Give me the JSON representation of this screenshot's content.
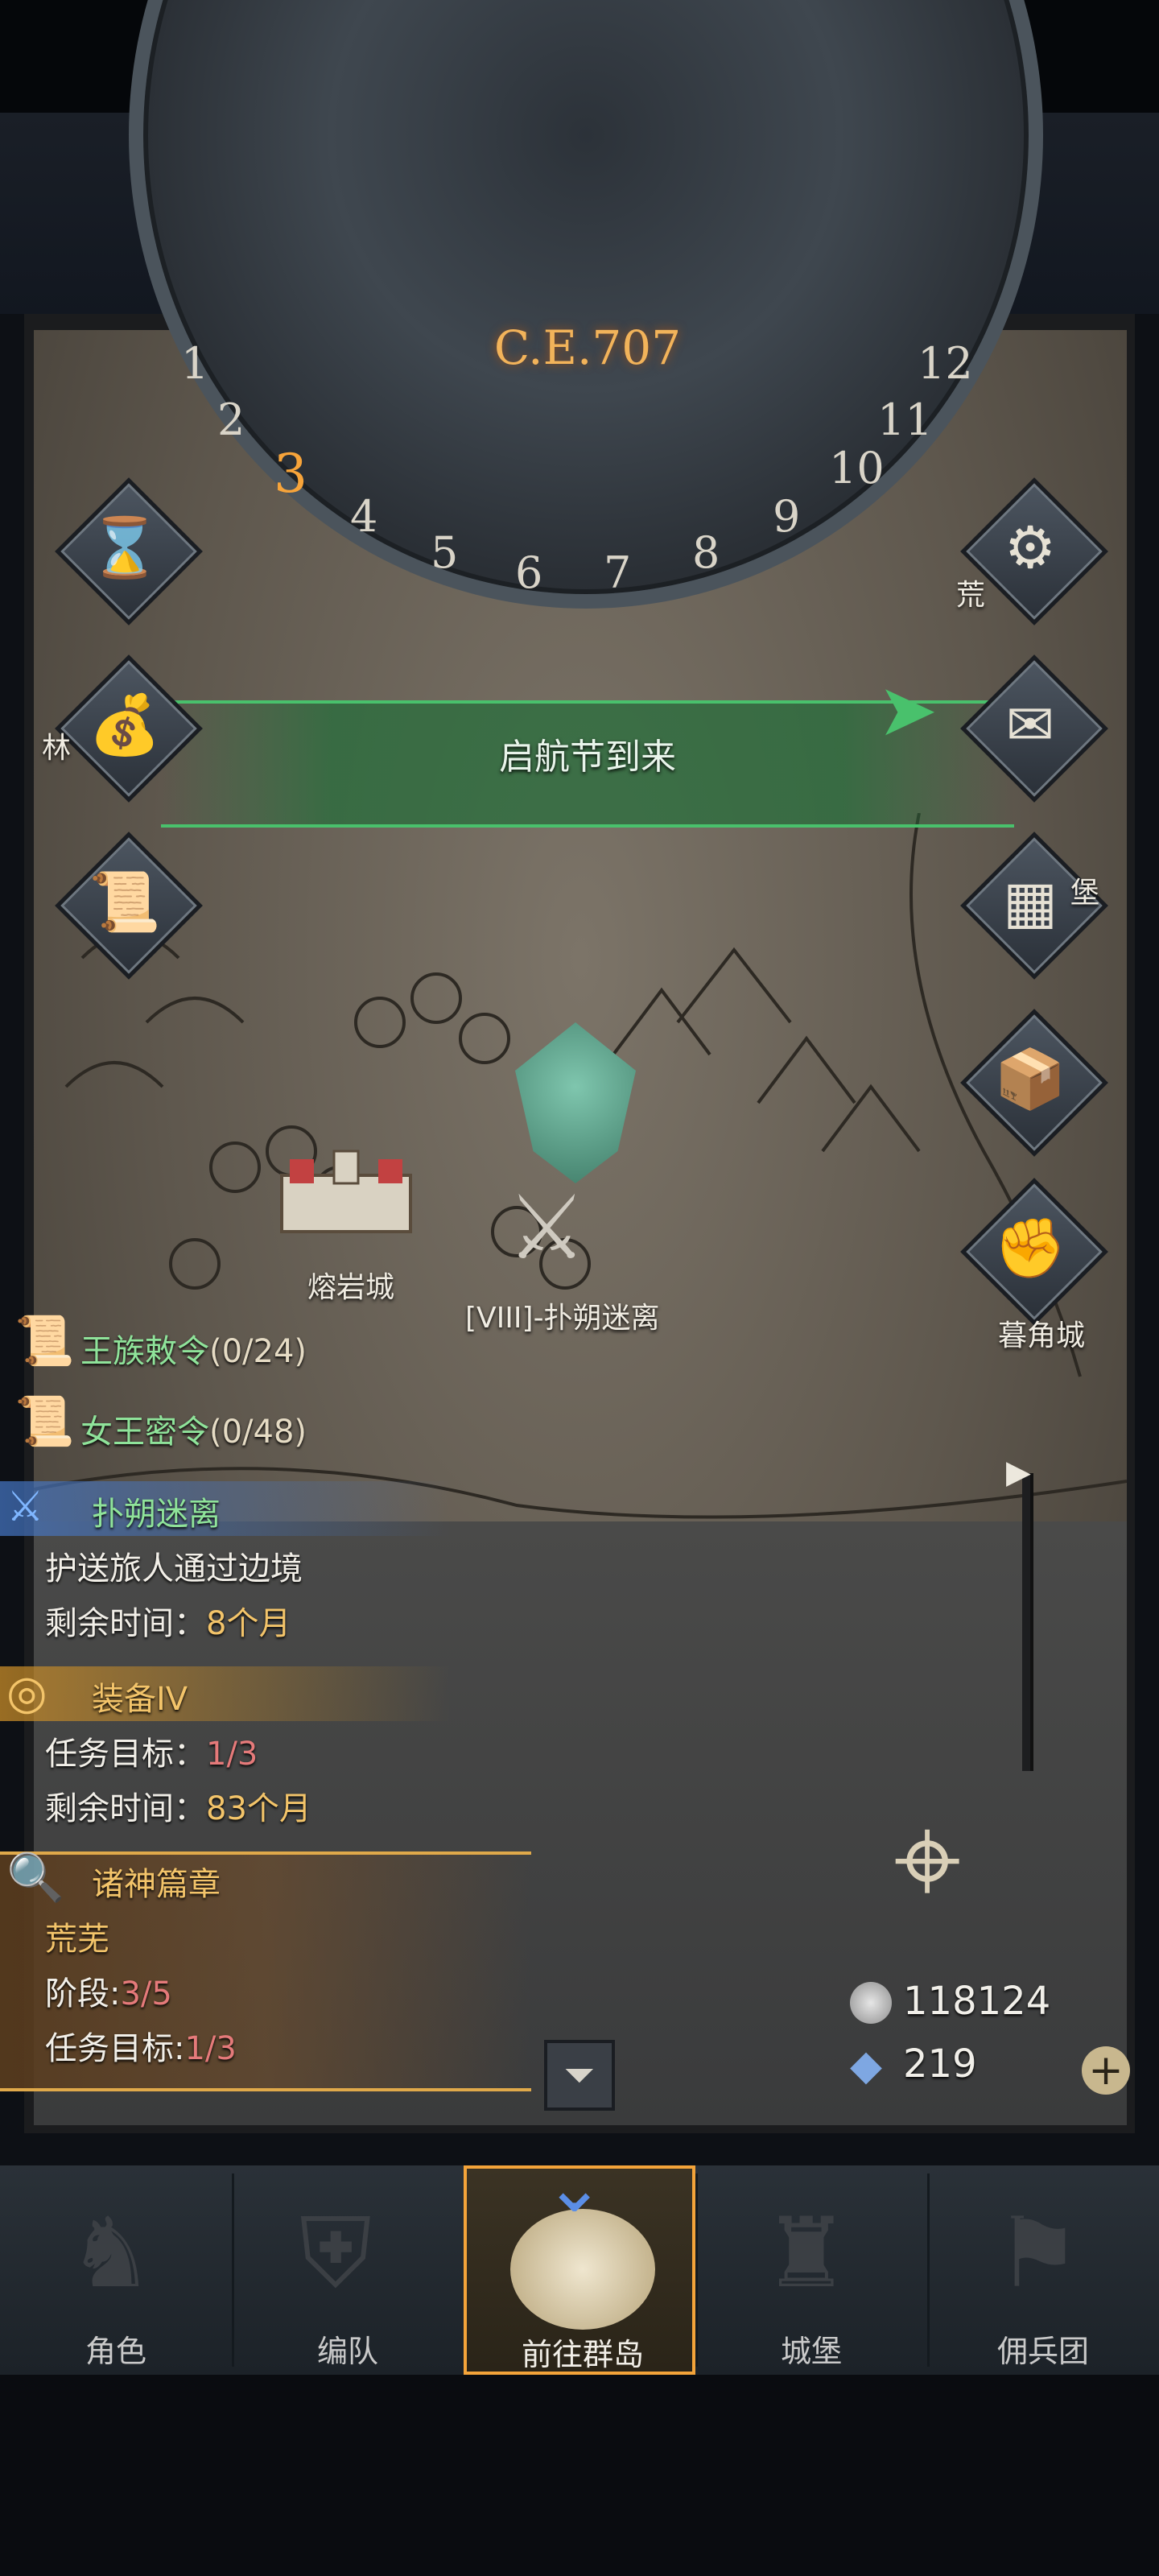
{
  "calendar": {
    "year": "C.E.707",
    "months": [
      "1",
      "2",
      "3",
      "4",
      "5",
      "6",
      "7",
      "8",
      "9",
      "10",
      "11",
      "12"
    ],
    "current_month": "3"
  },
  "event_banner": "启航节到来",
  "side_icons_left": [
    "hourglass-icon",
    "money-bag-icon",
    "scroll-icon"
  ],
  "side_icons_right": [
    "gear-icon",
    "mail-icon",
    "grid-icon",
    "cargo-icon",
    "sword-fist-icon"
  ],
  "cities": {
    "lava_city": "熔岩城",
    "dusk_city": "暮角城",
    "wild_partial": "荒",
    "forest_partial": "林",
    "fort_partial": "堡"
  },
  "unit": {
    "label": "[VIII]-扑朔迷离"
  },
  "orders": [
    {
      "name": "王族敕令",
      "count": "(0/24)"
    },
    {
      "name": "女王密令",
      "count": "(0/48)"
    }
  ],
  "quests": [
    {
      "title": "扑朔迷离",
      "desc": "护送旅人通过边境",
      "time_label": "剩余时间：",
      "time_value": "8个月"
    },
    {
      "title": "装备IV",
      "goal_label": "任务目标：",
      "goal_value": "1/3",
      "time_label": "剩余时间：",
      "time_value": "83个月"
    },
    {
      "title": "诸神篇章",
      "sub": "荒芜",
      "stage_label": "阶段:",
      "stage_value": "3/5",
      "goal_label": "任务目标:",
      "goal_value": "1/3"
    }
  ],
  "resources": {
    "silver": "118124",
    "crystal": "219"
  },
  "nav": [
    {
      "label": "角色"
    },
    {
      "label": "编队"
    },
    {
      "label": "前往群岛"
    },
    {
      "label": "城堡"
    },
    {
      "label": "佣兵团"
    }
  ],
  "colors": {
    "accent_orange": "#f4a43a",
    "banner_green": "#49c16c",
    "quest_green": "#8fe39a",
    "quest_gold": "#f3c46a"
  }
}
